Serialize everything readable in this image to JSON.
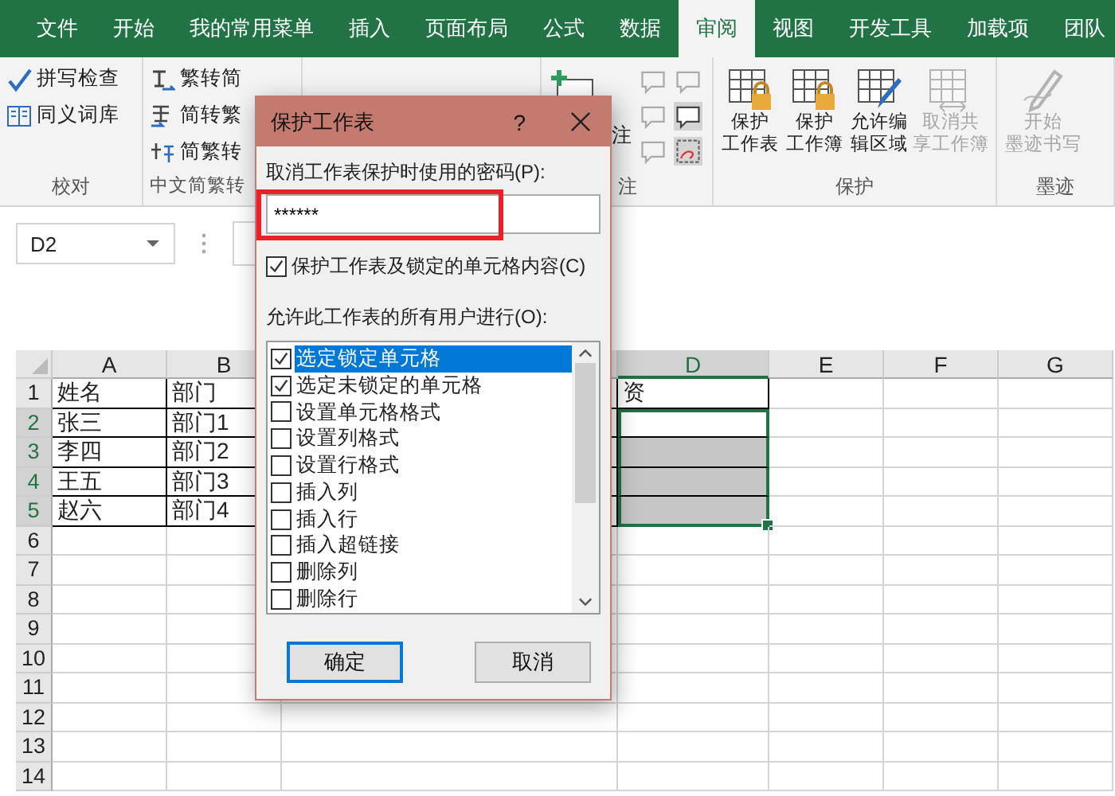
{
  "tabs": [
    {
      "label": "文件",
      "selected": false
    },
    {
      "label": "开始",
      "selected": false
    },
    {
      "label": "我的常用菜单",
      "selected": false
    },
    {
      "label": "插入",
      "selected": false
    },
    {
      "label": "页面布局",
      "selected": false
    },
    {
      "label": "公式",
      "selected": false
    },
    {
      "label": "数据",
      "selected": false
    },
    {
      "label": "审阅",
      "selected": true
    },
    {
      "label": "视图",
      "selected": false
    },
    {
      "label": "开发工具",
      "selected": false
    },
    {
      "label": "加载项",
      "selected": false
    },
    {
      "label": "团队",
      "selected": false
    }
  ],
  "ribbon": {
    "proofing": {
      "label": "校对",
      "items": [
        {
          "kind": "spell",
          "label": "拼写检查"
        },
        {
          "kind": "thesaurus",
          "label": "同义词库"
        }
      ]
    },
    "chinese": {
      "label": "中文简繁转",
      "items": [
        {
          "kind": "trad2simp",
          "label": "繁转简"
        },
        {
          "kind": "simp2trad",
          "label": "简转繁"
        },
        {
          "kind": "convert",
          "label": "简繁转"
        }
      ]
    },
    "comments": {
      "label": "注",
      "new_label": "注"
    },
    "protect": {
      "label": "保护",
      "items": [
        {
          "kind": "sheet",
          "lines": [
            "保护",
            "工作表"
          ],
          "disabled": false
        },
        {
          "kind": "book",
          "lines": [
            "保护",
            "工作簿"
          ],
          "disabled": false
        },
        {
          "kind": "edit",
          "lines": [
            "允许编",
            "辑区域"
          ],
          "disabled": false
        },
        {
          "kind": "share",
          "lines": [
            "取消共",
            "享工作簿"
          ],
          "disabled": true
        }
      ]
    },
    "ink": {
      "label": "墨迹",
      "items": [
        {
          "kind": "ink",
          "lines": [
            "开始",
            "墨迹书写"
          ],
          "disabled": true
        }
      ]
    }
  },
  "name_box": "D2",
  "sheet": {
    "columns": [
      {
        "label": "A"
      },
      {
        "label": "B"
      },
      {},
      {
        "label": "D"
      },
      {
        "label": "E"
      },
      {
        "label": "F"
      },
      {
        "label": "G"
      }
    ],
    "rows": [
      {
        "number": "1",
        "cells": [
          "姓名",
          "部门",
          "",
          "资"
        ],
        "bordered": true,
        "selected": false
      },
      {
        "number": "2",
        "cells": [
          "张三",
          "部门1",
          "",
          ""
        ],
        "bordered": true,
        "selected": true
      },
      {
        "number": "3",
        "cells": [
          "李四",
          "部门2",
          "",
          ""
        ],
        "bordered": true,
        "selected": true
      },
      {
        "number": "4",
        "cells": [
          "王五",
          "部门3",
          "",
          ""
        ],
        "bordered": true,
        "selected": true
      },
      {
        "number": "5",
        "cells": [
          "赵六",
          "部门4",
          "",
          ""
        ],
        "bordered": true,
        "selected": true
      },
      {
        "number": "6",
        "cells": [],
        "bordered": false,
        "selected": false
      },
      {
        "number": "7",
        "cells": [],
        "bordered": false,
        "selected": false
      },
      {
        "number": "8",
        "cells": [],
        "bordered": false,
        "selected": false
      },
      {
        "number": "9",
        "cells": [],
        "bordered": false,
        "selected": false
      },
      {
        "number": "10",
        "cells": [],
        "bordered": false,
        "selected": false
      },
      {
        "number": "11",
        "cells": [],
        "bordered": false,
        "selected": false
      },
      {
        "number": "12",
        "cells": [],
        "bordered": false,
        "selected": false
      },
      {
        "number": "13",
        "cells": [],
        "bordered": false,
        "selected": false
      },
      {
        "number": "14",
        "cells": [],
        "bordered": false,
        "selected": false
      }
    ]
  },
  "dialog": {
    "title": "保护工作表",
    "help": "?",
    "password_label": "取消工作表保护时使用的密码(P):",
    "password": {
      "value": "******"
    },
    "protect_checkbox": {
      "label": "保护工作表及锁定的单元格内容(C)",
      "checked": true
    },
    "permissions_label": "允许此工作表的所有用户进行(O):",
    "permissions": [
      {
        "label": "选定锁定单元格",
        "checked": true,
        "selected": true
      },
      {
        "label": "选定未锁定的单元格",
        "checked": true,
        "selected": false
      },
      {
        "label": "设置单元格格式",
        "checked": false,
        "selected": false
      },
      {
        "label": "设置列格式",
        "checked": false,
        "selected": false
      },
      {
        "label": "设置行格式",
        "checked": false,
        "selected": false
      },
      {
        "label": "插入列",
        "checked": false,
        "selected": false
      },
      {
        "label": "插入行",
        "checked": false,
        "selected": false
      },
      {
        "label": "插入超链接",
        "checked": false,
        "selected": false
      },
      {
        "label": "删除列",
        "checked": false,
        "selected": false
      },
      {
        "label": "删除行",
        "checked": false,
        "selected": false
      }
    ],
    "buttons": [
      {
        "label": "确定",
        "default": true
      },
      {
        "label": "取消",
        "default": false
      }
    ]
  }
}
